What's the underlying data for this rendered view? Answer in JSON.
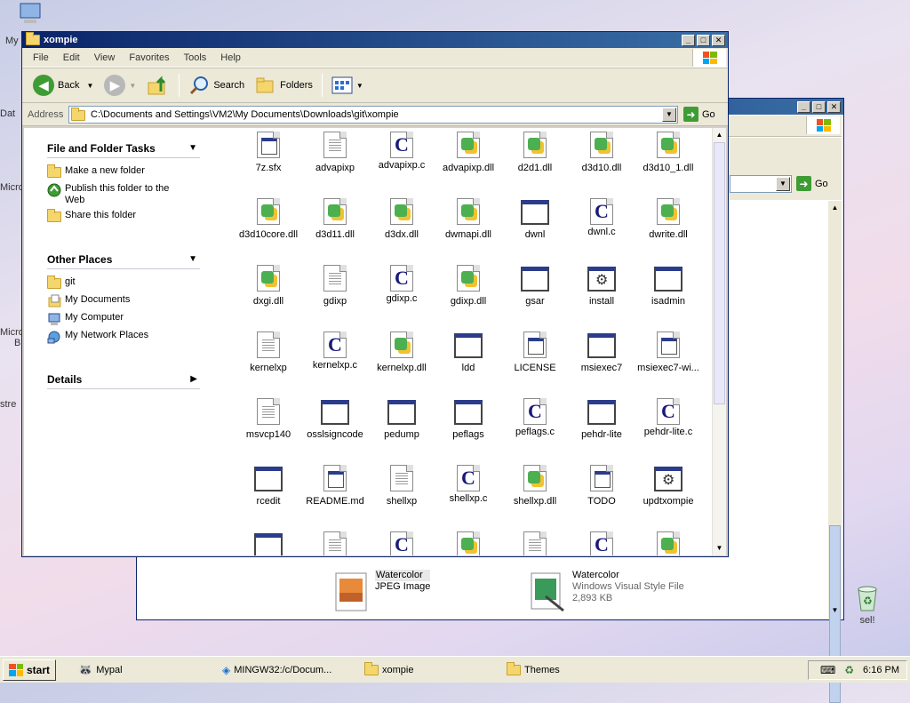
{
  "desktop": {
    "fragments": [
      "My",
      "Dat",
      "Micro",
      "Micro",
      "B",
      "stre"
    ],
    "recycle_label": "sel!"
  },
  "back_window": {
    "files": [
      {
        "name": "Watercolor",
        "type": "JPEG Image"
      },
      {
        "name": "Watercolor",
        "type": "Windows Visual Style File",
        "size": "2,893 KB"
      }
    ],
    "go_label": "Go"
  },
  "window": {
    "title": "xompie",
    "menu": [
      "File",
      "Edit",
      "View",
      "Favorites",
      "Tools",
      "Help"
    ],
    "toolbar": {
      "back": "Back",
      "search": "Search",
      "folders": "Folders"
    },
    "address": {
      "label": "Address",
      "value": "C:\\Documents and Settings\\VM2\\My Documents\\Downloads\\git\\xompie",
      "go": "Go"
    }
  },
  "tasks": {
    "file_folder_title": "File and Folder Tasks",
    "file_folder_items": [
      "Make a new folder",
      "Publish this folder to the Web",
      "Share this folder"
    ],
    "other_places_title": "Other Places",
    "other_places_items": [
      "git",
      "My Documents",
      "My Computer",
      "My Network Places"
    ],
    "details_title": "Details"
  },
  "files": [
    {
      "name": "7z.sfx",
      "icon": "sfx"
    },
    {
      "name": "advapixp",
      "icon": "txt"
    },
    {
      "name": "advapixp.c",
      "icon": "c"
    },
    {
      "name": "advapixp.dll",
      "icon": "dll"
    },
    {
      "name": "d2d1.dll",
      "icon": "dll"
    },
    {
      "name": "d3d10.dll",
      "icon": "dll"
    },
    {
      "name": "d3d10_1.dll",
      "icon": "dll"
    },
    {
      "name": "d3d10core.dll",
      "icon": "dll"
    },
    {
      "name": "d3d11.dll",
      "icon": "dll"
    },
    {
      "name": "d3dx.dll",
      "icon": "dll"
    },
    {
      "name": "dwmapi.dll",
      "icon": "dll"
    },
    {
      "name": "dwnl",
      "icon": "exe"
    },
    {
      "name": "dwnl.c",
      "icon": "c"
    },
    {
      "name": "dwrite.dll",
      "icon": "dll"
    },
    {
      "name": "dxgi.dll",
      "icon": "dll"
    },
    {
      "name": "gdixp",
      "icon": "txt"
    },
    {
      "name": "gdixp.c",
      "icon": "c"
    },
    {
      "name": "gdixp.dll",
      "icon": "dll"
    },
    {
      "name": "gsar",
      "icon": "exe"
    },
    {
      "name": "install",
      "icon": "gear"
    },
    {
      "name": "isadmin",
      "icon": "exe"
    },
    {
      "name": "kernelxp",
      "icon": "txt"
    },
    {
      "name": "kernelxp.c",
      "icon": "c"
    },
    {
      "name": "kernelxp.dll",
      "icon": "dll"
    },
    {
      "name": "ldd",
      "icon": "exe"
    },
    {
      "name": "LICENSE",
      "icon": "sfx"
    },
    {
      "name": "msiexec7",
      "icon": "exe"
    },
    {
      "name": "msiexec7-wi...",
      "icon": "sfx"
    },
    {
      "name": "msvcp140",
      "icon": "txt"
    },
    {
      "name": "osslsigncode",
      "icon": "exe"
    },
    {
      "name": "pedump",
      "icon": "exe"
    },
    {
      "name": "peflags",
      "icon": "exe"
    },
    {
      "name": "peflags.c",
      "icon": "c"
    },
    {
      "name": "pehdr-lite",
      "icon": "exe"
    },
    {
      "name": "pehdr-lite.c",
      "icon": "c"
    },
    {
      "name": "rcedit",
      "icon": "exe"
    },
    {
      "name": "README.md",
      "icon": "sfx"
    },
    {
      "name": "shellxp",
      "icon": "txt"
    },
    {
      "name": "shellxp.c",
      "icon": "c"
    },
    {
      "name": "shellxp.dll",
      "icon": "dll"
    },
    {
      "name": "TODO",
      "icon": "sfx"
    },
    {
      "name": "updtxompie",
      "icon": "gear"
    },
    {
      "name": "",
      "icon": "exe"
    },
    {
      "name": "",
      "icon": "txt"
    },
    {
      "name": "",
      "icon": "c"
    },
    {
      "name": "",
      "icon": "dll"
    },
    {
      "name": "",
      "icon": "txt"
    },
    {
      "name": "",
      "icon": "c"
    },
    {
      "name": "",
      "icon": "dll"
    }
  ],
  "taskbar": {
    "start": "start",
    "items": [
      "Mypal",
      "MINGW32:/c/Docum...",
      "xompie",
      "Themes"
    ],
    "clock": "6:16 PM"
  }
}
